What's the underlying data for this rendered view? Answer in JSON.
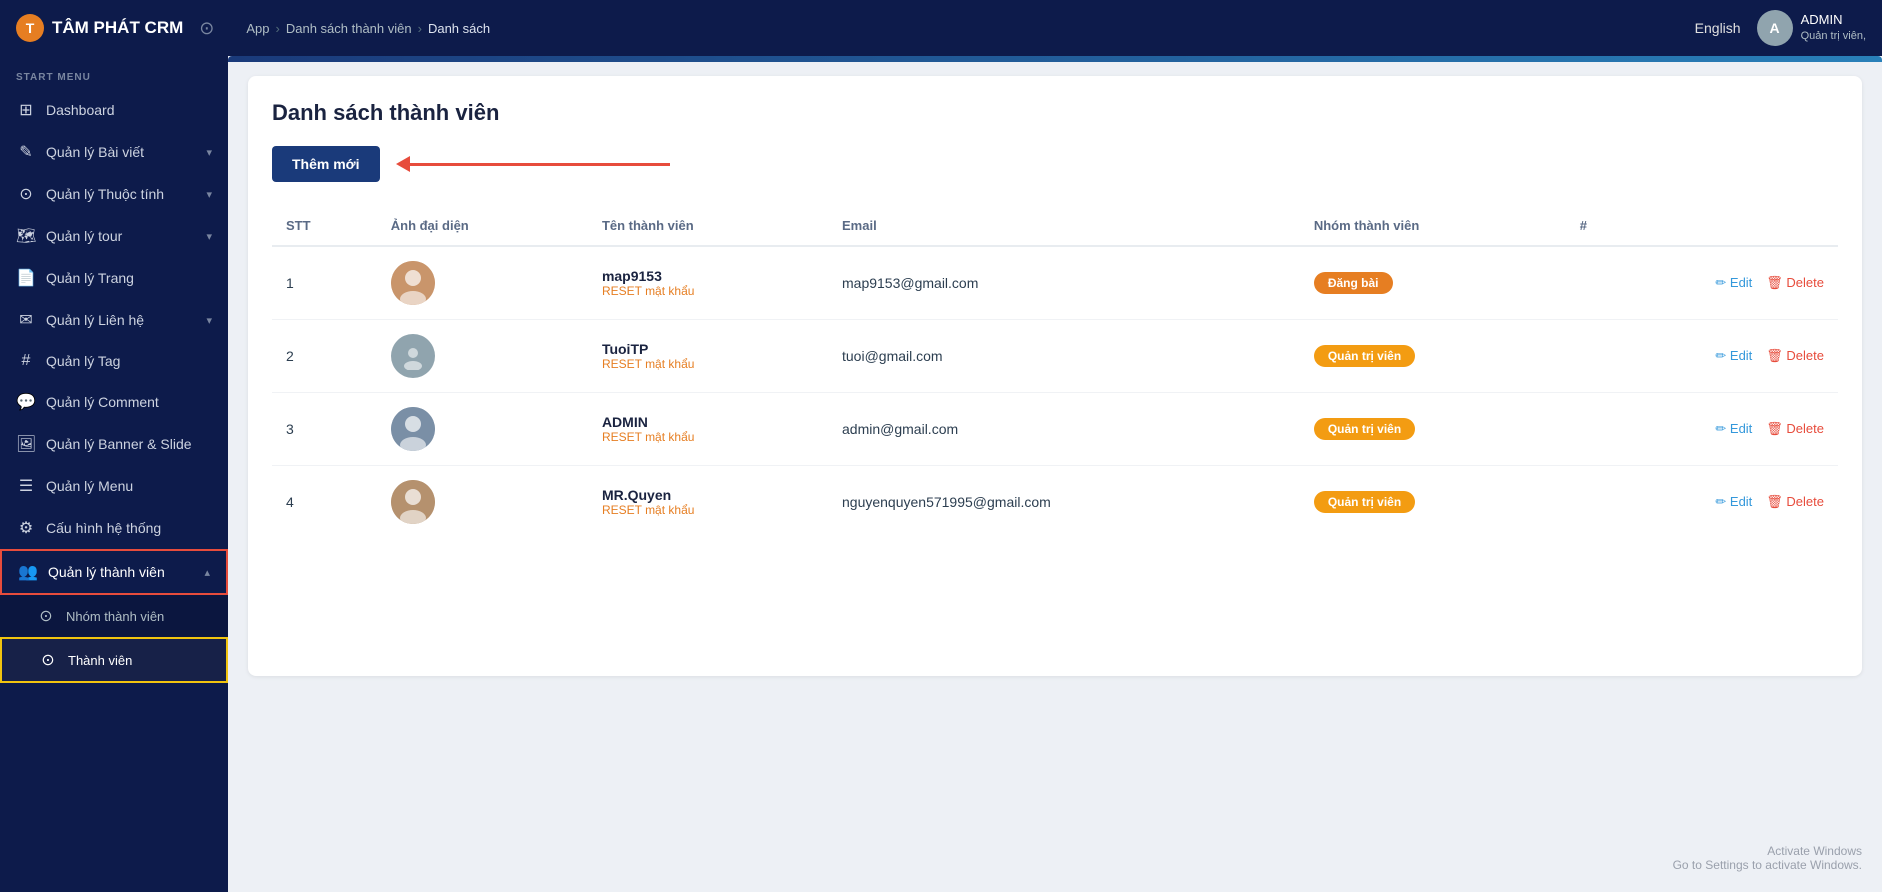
{
  "topnav": {
    "logo_icon": "T",
    "logo_text": "TÂM PHÁT CRM",
    "back_icon": "⊙",
    "breadcrumb": [
      "App",
      "Danh sách thành viên",
      "Danh sách"
    ],
    "lang": "English",
    "user_initials": "A",
    "username": "ADMIN",
    "user_role": "Quản trị viên,"
  },
  "sidebar": {
    "section_label": "START MENU",
    "items": [
      {
        "id": "dashboard",
        "label": "Dashboard",
        "icon": "⊞",
        "has_sub": false
      },
      {
        "id": "quan-ly-bai-viet",
        "label": "Quản lý Bài viết",
        "icon": "✎",
        "has_sub": true
      },
      {
        "id": "quan-ly-thuoc-tinh",
        "label": "Quản lý Thuộc tính",
        "icon": "⊙",
        "has_sub": true
      },
      {
        "id": "quan-ly-tour",
        "label": "Quản lý tour",
        "icon": "🗺",
        "has_sub": true
      },
      {
        "id": "quan-ly-trang",
        "label": "Quản lý Trang",
        "icon": "📄",
        "has_sub": false
      },
      {
        "id": "quan-ly-lien-he",
        "label": "Quản lý Liên hệ",
        "icon": "✉",
        "has_sub": true
      },
      {
        "id": "quan-ly-tag",
        "label": "Quản lý Tag",
        "icon": "#",
        "has_sub": false
      },
      {
        "id": "quan-ly-comment",
        "label": "Quản lý Comment",
        "icon": "💬",
        "has_sub": false
      },
      {
        "id": "quan-ly-banner-slide",
        "label": "Quản lý Banner & Slide",
        "icon": "🖼",
        "has_sub": false
      },
      {
        "id": "quan-ly-menu",
        "label": "Quản lý Menu",
        "icon": "☰",
        "has_sub": false
      },
      {
        "id": "cau-hinh-he-thong",
        "label": "Cấu hình hệ thống",
        "icon": "⚙",
        "has_sub": false
      },
      {
        "id": "quan-ly-thanh-vien",
        "label": "Quản lý thành viên",
        "icon": "👥",
        "has_sub": true,
        "active_parent": true
      }
    ],
    "sub_items": [
      {
        "id": "nhom-thanh-vien",
        "label": "Nhóm thành viên",
        "icon": "⊙"
      },
      {
        "id": "thanh-vien",
        "label": "Thành viên",
        "icon": "⊙",
        "active_child": true
      }
    ]
  },
  "main": {
    "title": "Danh sách thành viên",
    "add_button_label": "Thêm mới",
    "table_headers": [
      "STT",
      "Ảnh đại diện",
      "Tên thành viên",
      "Email",
      "Nhóm thành viên",
      "#"
    ],
    "members": [
      {
        "stt": 1,
        "avatar_type": "image",
        "avatar_bg": "#e8b4a0",
        "name": "map9153",
        "reset_label": "RESET mật khẩu",
        "email": "map9153@gmail.com",
        "group": "Đăng bài",
        "group_badge_class": "badge-dang-bai"
      },
      {
        "stt": 2,
        "avatar_type": "placeholder",
        "avatar_bg": "#90a4ae",
        "name": "TuoiTP",
        "reset_label": "RESET mật khẩu",
        "email": "tuoi@gmail.com",
        "group": "Quản trị viên",
        "group_badge_class": "badge-quan-tri"
      },
      {
        "stt": 3,
        "avatar_type": "image",
        "avatar_bg": "#7a8fa6",
        "name": "ADMIN",
        "reset_label": "RESET mật khẩu",
        "email": "admin@gmail.com",
        "group": "Quản trị viên",
        "group_badge_class": "badge-quan-tri"
      },
      {
        "stt": 4,
        "avatar_type": "image",
        "avatar_bg": "#c4a882",
        "name": "MR.Quyen",
        "reset_label": "RESET mật khẩu",
        "email": "nguyenquyen571995@gmail.com",
        "group": "Quản trị viên",
        "group_badge_class": "badge-quan-tri"
      }
    ],
    "edit_label": "Edit",
    "delete_label": "Delete"
  },
  "watermark": {
    "line1": "Activate Windows",
    "line2": "Go to Settings to activate Windows."
  }
}
